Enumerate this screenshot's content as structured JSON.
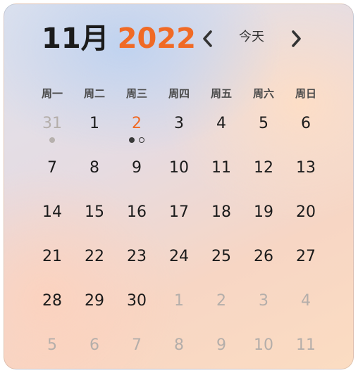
{
  "calendar": {
    "month_label": "11月",
    "year_label": "2022",
    "today_label": "今天",
    "prev_icon": "chevron-left-icon",
    "next_icon": "chevron-right-icon",
    "accent_color": "#f06a25",
    "weekdays": [
      "周一",
      "周二",
      "周三",
      "周四",
      "周五",
      "周六",
      "周日"
    ],
    "weeks": [
      [
        {
          "day": "31",
          "muted": true,
          "dots": [
            "gray"
          ]
        },
        {
          "day": "1"
        },
        {
          "day": "2",
          "today": true,
          "dots": [
            "dark",
            "hollow"
          ]
        },
        {
          "day": "3"
        },
        {
          "day": "4"
        },
        {
          "day": "5"
        },
        {
          "day": "6"
        }
      ],
      [
        {
          "day": "7"
        },
        {
          "day": "8"
        },
        {
          "day": "9"
        },
        {
          "day": "10"
        },
        {
          "day": "11"
        },
        {
          "day": "12"
        },
        {
          "day": "13"
        }
      ],
      [
        {
          "day": "14"
        },
        {
          "day": "15"
        },
        {
          "day": "16"
        },
        {
          "day": "17"
        },
        {
          "day": "18"
        },
        {
          "day": "19"
        },
        {
          "day": "20"
        }
      ],
      [
        {
          "day": "21"
        },
        {
          "day": "22"
        },
        {
          "day": "23"
        },
        {
          "day": "24"
        },
        {
          "day": "25"
        },
        {
          "day": "26"
        },
        {
          "day": "27"
        }
      ],
      [
        {
          "day": "28"
        },
        {
          "day": "29"
        },
        {
          "day": "30"
        },
        {
          "day": "1",
          "muted": true
        },
        {
          "day": "2",
          "muted": true
        },
        {
          "day": "3",
          "muted": true
        },
        {
          "day": "4",
          "muted": true
        }
      ],
      [
        {
          "day": "5",
          "muted": true
        },
        {
          "day": "6",
          "muted": true
        },
        {
          "day": "7",
          "muted": true
        },
        {
          "day": "8",
          "muted": true
        },
        {
          "day": "9",
          "muted": true
        },
        {
          "day": "10",
          "muted": true
        },
        {
          "day": "11",
          "muted": true
        }
      ]
    ]
  }
}
